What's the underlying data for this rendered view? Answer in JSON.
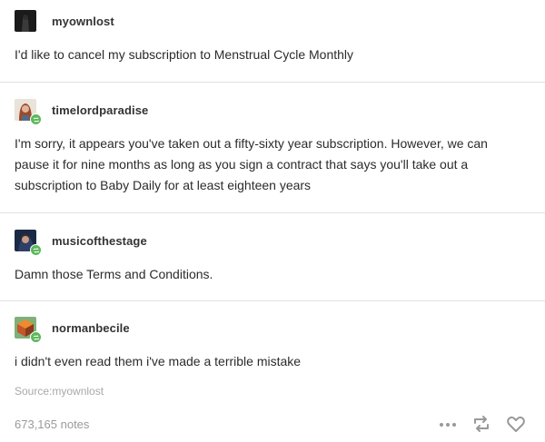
{
  "posts": [
    {
      "username": "myownlost",
      "text": "I'd like to cancel my subscription to Menstrual Cycle Monthly"
    },
    {
      "username": "timelordparadise",
      "text": "I'm sorry, it appears you've taken out a fifty-sixty year subscription. However, we can pause it for nine months as long as you sign a contract that says you'll take out a subscription to Baby Daily for at least eighteen years"
    },
    {
      "username": "musicofthestage",
      "text": "Damn those Terms and Conditions."
    },
    {
      "username": "normanbecile",
      "text": "i didn't even read them i've made a terrible mistake"
    }
  ],
  "footer": {
    "source": "Source:myownlost",
    "notes": "673,165 notes"
  },
  "icons": {
    "more": "ellipsis-icon",
    "reblog": "reblog-icon",
    "like": "heart-icon",
    "badge": "reblog-badge-icon"
  },
  "colors": {
    "badge": "#5cb85c",
    "divider": "#e2e2e2",
    "muted": "#9a9a9a"
  }
}
